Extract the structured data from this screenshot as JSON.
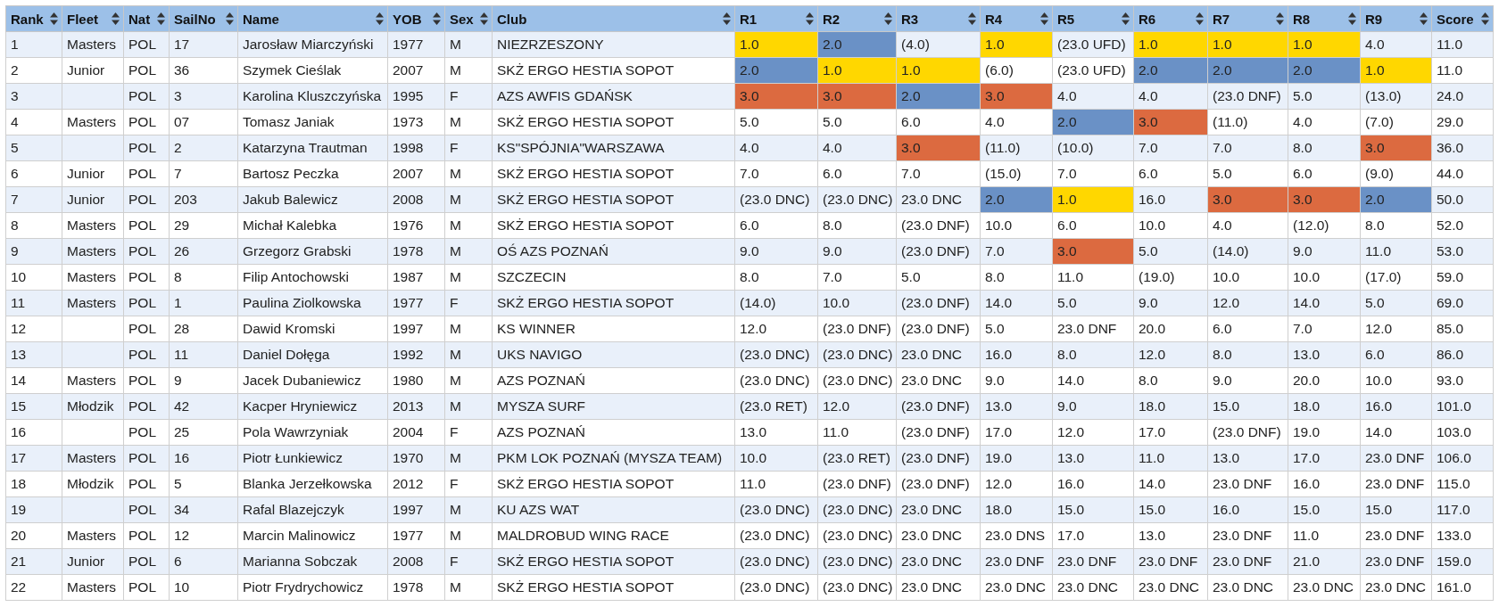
{
  "table": {
    "columns": [
      "Rank",
      "Fleet",
      "Nat",
      "SailNo",
      "Name",
      "YOB",
      "Sex",
      "Club",
      "R1",
      "R2",
      "R3",
      "R4",
      "R5",
      "R6",
      "R7",
      "R8",
      "R9",
      "Score"
    ],
    "rows": [
      {
        "rank": "1",
        "fleet": "Masters",
        "nat": "POL",
        "sail_no": "17",
        "name": "Jarosław Miarczyński",
        "yob": "1977",
        "sex": "M",
        "club": "NIEZRZESZONY",
        "races": [
          {
            "text": "1.0",
            "color": "#ffd700"
          },
          {
            "text": "2.0",
            "color": "#6a91c6"
          },
          {
            "text": "(4.0)"
          },
          {
            "text": "1.0",
            "color": "#ffd700"
          },
          {
            "text": "(23.0 UFD)"
          },
          {
            "text": "1.0",
            "color": "#ffd700"
          },
          {
            "text": "1.0",
            "color": "#ffd700"
          },
          {
            "text": "1.0",
            "color": "#ffd700"
          },
          {
            "text": "4.0"
          }
        ],
        "score": "11.0"
      },
      {
        "rank": "2",
        "fleet": "Junior",
        "nat": "POL",
        "sail_no": "36",
        "name": "Szymek Cieślak",
        "yob": "2007",
        "sex": "M",
        "club": "SKŻ ERGO HESTIA SOPOT",
        "races": [
          {
            "text": "2.0",
            "color": "#6a91c6"
          },
          {
            "text": "1.0",
            "color": "#ffd700"
          },
          {
            "text": "1.0",
            "color": "#ffd700"
          },
          {
            "text": "(6.0)"
          },
          {
            "text": "(23.0 UFD)"
          },
          {
            "text": "2.0",
            "color": "#6a91c6"
          },
          {
            "text": "2.0",
            "color": "#6a91c6"
          },
          {
            "text": "2.0",
            "color": "#6a91c6"
          },
          {
            "text": "1.0",
            "color": "#ffd700"
          }
        ],
        "score": "11.0"
      },
      {
        "rank": "3",
        "nat": "POL",
        "sail_no": "3",
        "name": "Karolina Kluszczyńska",
        "yob": "1995",
        "sex": "F",
        "club": "AZS AWFIS GDAŃSK",
        "races": [
          {
            "text": "3.0",
            "color": "#dc6a40"
          },
          {
            "text": "3.0",
            "color": "#dc6a40"
          },
          {
            "text": "2.0",
            "color": "#6a91c6"
          },
          {
            "text": "3.0",
            "color": "#dc6a40"
          },
          {
            "text": "4.0"
          },
          {
            "text": "4.0"
          },
          {
            "text": "(23.0 DNF)"
          },
          {
            "text": "5.0"
          },
          {
            "text": "(13.0)"
          }
        ],
        "score": "24.0"
      },
      {
        "rank": "4",
        "fleet": "Masters",
        "nat": "POL",
        "sail_no": "07",
        "name": "Tomasz Janiak",
        "yob": "1973",
        "sex": "M",
        "club": "SKŻ ERGO HESTIA SOPOT",
        "races": [
          {
            "text": "5.0"
          },
          {
            "text": "5.0"
          },
          {
            "text": "6.0"
          },
          {
            "text": "4.0"
          },
          {
            "text": "2.0",
            "color": "#6a91c6"
          },
          {
            "text": "3.0",
            "color": "#dc6a40"
          },
          {
            "text": "(11.0)"
          },
          {
            "text": "4.0"
          },
          {
            "text": "(7.0)"
          }
        ],
        "score": "29.0"
      },
      {
        "rank": "5",
        "nat": "POL",
        "sail_no": "2",
        "name": "Katarzyna Trautman",
        "yob": "1998",
        "sex": "F",
        "club": "KS\"SPÓJNIA\"WARSZAWA",
        "races": [
          {
            "text": "4.0"
          },
          {
            "text": "4.0"
          },
          {
            "text": "3.0",
            "color": "#dc6a40"
          },
          {
            "text": "(11.0)"
          },
          {
            "text": "(10.0)"
          },
          {
            "text": "7.0"
          },
          {
            "text": "7.0"
          },
          {
            "text": "8.0"
          },
          {
            "text": "3.0",
            "color": "#dc6a40"
          }
        ],
        "score": "36.0"
      },
      {
        "rank": "6",
        "fleet": "Junior",
        "nat": "POL",
        "sail_no": "7",
        "name": "Bartosz Peczka",
        "yob": "2007",
        "sex": "M",
        "club": "SKŻ ERGO HESTIA SOPOT",
        "races": [
          {
            "text": "7.0"
          },
          {
            "text": "6.0"
          },
          {
            "text": "7.0"
          },
          {
            "text": "(15.0)"
          },
          {
            "text": "7.0"
          },
          {
            "text": "6.0"
          },
          {
            "text": "5.0"
          },
          {
            "text": "6.0"
          },
          {
            "text": "(9.0)"
          }
        ],
        "score": "44.0"
      },
      {
        "rank": "7",
        "fleet": "Junior",
        "nat": "POL",
        "sail_no": "203",
        "name": "Jakub Balewicz",
        "yob": "2008",
        "sex": "M",
        "club": "SKŻ ERGO HESTIA SOPOT",
        "races": [
          {
            "text": "(23.0 DNC)"
          },
          {
            "text": "(23.0 DNC)"
          },
          {
            "text": "23.0 DNC"
          },
          {
            "text": "2.0",
            "color": "#6a91c6"
          },
          {
            "text": "1.0",
            "color": "#ffd700"
          },
          {
            "text": "16.0"
          },
          {
            "text": "3.0",
            "color": "#dc6a40"
          },
          {
            "text": "3.0",
            "color": "#dc6a40"
          },
          {
            "text": "2.0",
            "color": "#6a91c6"
          }
        ],
        "score": "50.0"
      },
      {
        "rank": "8",
        "fleet": "Masters",
        "nat": "POL",
        "sail_no": "29",
        "name": "Michał Kalebka",
        "yob": "1976",
        "sex": "M",
        "club": "SKŻ ERGO HESTIA SOPOT",
        "races": [
          {
            "text": "6.0"
          },
          {
            "text": "8.0"
          },
          {
            "text": "(23.0 DNF)"
          },
          {
            "text": "10.0"
          },
          {
            "text": "6.0"
          },
          {
            "text": "10.0"
          },
          {
            "text": "4.0"
          },
          {
            "text": "(12.0)"
          },
          {
            "text": "8.0"
          }
        ],
        "score": "52.0"
      },
      {
        "rank": "9",
        "fleet": "Masters",
        "nat": "POL",
        "sail_no": "26",
        "name": "Grzegorz Grabski",
        "yob": "1978",
        "sex": "M",
        "club": "OŚ AZS POZNAŃ",
        "races": [
          {
            "text": "9.0"
          },
          {
            "text": "9.0"
          },
          {
            "text": "(23.0 DNF)"
          },
          {
            "text": "7.0"
          },
          {
            "text": "3.0",
            "color": "#dc6a40"
          },
          {
            "text": "5.0"
          },
          {
            "text": "(14.0)"
          },
          {
            "text": "9.0"
          },
          {
            "text": "11.0"
          }
        ],
        "score": "53.0"
      },
      {
        "rank": "10",
        "fleet": "Masters",
        "nat": "POL",
        "sail_no": "8",
        "name": "Filip Antochowski",
        "yob": "1987",
        "sex": "M",
        "club": "SZCZECIN",
        "races": [
          {
            "text": "8.0"
          },
          {
            "text": "7.0"
          },
          {
            "text": "5.0"
          },
          {
            "text": "8.0"
          },
          {
            "text": "11.0"
          },
          {
            "text": "(19.0)"
          },
          {
            "text": "10.0"
          },
          {
            "text": "10.0"
          },
          {
            "text": "(17.0)"
          }
        ],
        "score": "59.0"
      },
      {
        "rank": "11",
        "fleet": "Masters",
        "nat": "POL",
        "sail_no": "1",
        "name": "Paulina Ziolkowska",
        "yob": "1977",
        "sex": "F",
        "club": "SKŻ ERGO HESTIA SOPOT",
        "races": [
          {
            "text": "(14.0)"
          },
          {
            "text": "10.0"
          },
          {
            "text": "(23.0 DNF)"
          },
          {
            "text": "14.0"
          },
          {
            "text": "5.0"
          },
          {
            "text": "9.0"
          },
          {
            "text": "12.0"
          },
          {
            "text": "14.0"
          },
          {
            "text": "5.0"
          }
        ],
        "score": "69.0"
      },
      {
        "rank": "12",
        "nat": "POL",
        "sail_no": "28",
        "name": "Dawid Kromski",
        "yob": "1997",
        "sex": "M",
        "club": "KS WINNER",
        "races": [
          {
            "text": "12.0"
          },
          {
            "text": "(23.0 DNF)"
          },
          {
            "text": "(23.0 DNF)"
          },
          {
            "text": "5.0"
          },
          {
            "text": "23.0 DNF"
          },
          {
            "text": "20.0"
          },
          {
            "text": "6.0"
          },
          {
            "text": "7.0"
          },
          {
            "text": "12.0"
          }
        ],
        "score": "85.0"
      },
      {
        "rank": "13",
        "nat": "POL",
        "sail_no": "11",
        "name": "Daniel Dołęga",
        "yob": "1992",
        "sex": "M",
        "club": "UKS NAVIGO",
        "races": [
          {
            "text": "(23.0 DNC)"
          },
          {
            "text": "(23.0 DNC)"
          },
          {
            "text": "23.0 DNC"
          },
          {
            "text": "16.0"
          },
          {
            "text": "8.0"
          },
          {
            "text": "12.0"
          },
          {
            "text": "8.0"
          },
          {
            "text": "13.0"
          },
          {
            "text": "6.0"
          }
        ],
        "score": "86.0"
      },
      {
        "rank": "14",
        "fleet": "Masters",
        "nat": "POL",
        "sail_no": "9",
        "name": "Jacek Dubaniewicz",
        "yob": "1980",
        "sex": "M",
        "club": "AZS POZNAŃ",
        "races": [
          {
            "text": "(23.0 DNC)"
          },
          {
            "text": "(23.0 DNC)"
          },
          {
            "text": "23.0 DNC"
          },
          {
            "text": "9.0"
          },
          {
            "text": "14.0"
          },
          {
            "text": "8.0"
          },
          {
            "text": "9.0"
          },
          {
            "text": "20.0"
          },
          {
            "text": "10.0"
          }
        ],
        "score": "93.0"
      },
      {
        "rank": "15",
        "fleet": "Młodzik",
        "nat": "POL",
        "sail_no": "42",
        "name": "Kacper Hryniewicz",
        "yob": "2013",
        "sex": "M",
        "club": "MYSZA SURF",
        "races": [
          {
            "text": "(23.0 RET)"
          },
          {
            "text": "12.0"
          },
          {
            "text": "(23.0 DNF)"
          },
          {
            "text": "13.0"
          },
          {
            "text": "9.0"
          },
          {
            "text": "18.0"
          },
          {
            "text": "15.0"
          },
          {
            "text": "18.0"
          },
          {
            "text": "16.0"
          }
        ],
        "score": "101.0"
      },
      {
        "rank": "16",
        "nat": "POL",
        "sail_no": "25",
        "name": "Pola Wawrzyniak",
        "yob": "2004",
        "sex": "F",
        "club": "AZS POZNAŃ",
        "races": [
          {
            "text": "13.0"
          },
          {
            "text": "11.0"
          },
          {
            "text": "(23.0 DNF)"
          },
          {
            "text": "17.0"
          },
          {
            "text": "12.0"
          },
          {
            "text": "17.0"
          },
          {
            "text": "(23.0 DNF)"
          },
          {
            "text": "19.0"
          },
          {
            "text": "14.0"
          }
        ],
        "score": "103.0"
      },
      {
        "rank": "17",
        "fleet": "Masters",
        "nat": "POL",
        "sail_no": "16",
        "name": "Piotr Łunkiewicz",
        "yob": "1970",
        "sex": "M",
        "club": "PKM LOK POZNAŃ (MYSZA TEAM)",
        "races": [
          {
            "text": "10.0"
          },
          {
            "text": "(23.0 RET)"
          },
          {
            "text": "(23.0 DNF)"
          },
          {
            "text": "19.0"
          },
          {
            "text": "13.0"
          },
          {
            "text": "11.0"
          },
          {
            "text": "13.0"
          },
          {
            "text": "17.0"
          },
          {
            "text": "23.0 DNF"
          }
        ],
        "score": "106.0"
      },
      {
        "rank": "18",
        "fleet": "Młodzik",
        "nat": "POL",
        "sail_no": "5",
        "name": "Blanka Jerzełkowska",
        "yob": "2012",
        "sex": "F",
        "club": "SKŻ ERGO HESTIA SOPOT",
        "races": [
          {
            "text": "11.0"
          },
          {
            "text": "(23.0 DNF)"
          },
          {
            "text": "(23.0 DNF)"
          },
          {
            "text": "12.0"
          },
          {
            "text": "16.0"
          },
          {
            "text": "14.0"
          },
          {
            "text": "23.0 DNF"
          },
          {
            "text": "16.0"
          },
          {
            "text": "23.0 DNF"
          }
        ],
        "score": "115.0"
      },
      {
        "rank": "19",
        "nat": "POL",
        "sail_no": "34",
        "name": "Rafal Blazejczyk",
        "yob": "1997",
        "sex": "M",
        "club": "KU AZS WAT",
        "races": [
          {
            "text": "(23.0 DNC)"
          },
          {
            "text": "(23.0 DNC)"
          },
          {
            "text": "23.0 DNC"
          },
          {
            "text": "18.0"
          },
          {
            "text": "15.0"
          },
          {
            "text": "15.0"
          },
          {
            "text": "16.0"
          },
          {
            "text": "15.0"
          },
          {
            "text": "15.0"
          }
        ],
        "score": "117.0"
      },
      {
        "rank": "20",
        "fleet": "Masters",
        "nat": "POL",
        "sail_no": "12",
        "name": "Marcin Malinowicz",
        "yob": "1977",
        "sex": "M",
        "club": "MALDROBUD WING RACE",
        "races": [
          {
            "text": "(23.0 DNC)"
          },
          {
            "text": "(23.0 DNC)"
          },
          {
            "text": "23.0 DNC"
          },
          {
            "text": "23.0 DNS"
          },
          {
            "text": "17.0"
          },
          {
            "text": "13.0"
          },
          {
            "text": "23.0 DNF"
          },
          {
            "text": "11.0"
          },
          {
            "text": "23.0 DNF"
          }
        ],
        "score": "133.0"
      },
      {
        "rank": "21",
        "fleet": "Junior",
        "nat": "POL",
        "sail_no": "6",
        "name": "Marianna Sobczak",
        "yob": "2008",
        "sex": "F",
        "club": "SKŻ ERGO HESTIA SOPOT",
        "races": [
          {
            "text": "(23.0 DNC)"
          },
          {
            "text": "(23.0 DNC)"
          },
          {
            "text": "23.0 DNC"
          },
          {
            "text": "23.0 DNF"
          },
          {
            "text": "23.0 DNF"
          },
          {
            "text": "23.0 DNF"
          },
          {
            "text": "23.0 DNF"
          },
          {
            "text": "21.0"
          },
          {
            "text": "23.0 DNF"
          }
        ],
        "score": "159.0"
      },
      {
        "rank": "22",
        "fleet": "Masters",
        "nat": "POL",
        "sail_no": "10",
        "name": "Piotr Frydrychowicz",
        "yob": "1978",
        "sex": "M",
        "club": "SKŻ ERGO HESTIA SOPOT",
        "races": [
          {
            "text": "(23.0 DNC)"
          },
          {
            "text": "(23.0 DNC)"
          },
          {
            "text": "23.0 DNC"
          },
          {
            "text": "23.0 DNC"
          },
          {
            "text": "23.0 DNC"
          },
          {
            "text": "23.0 DNC"
          },
          {
            "text": "23.0 DNC"
          },
          {
            "text": "23.0 DNC"
          },
          {
            "text": "23.0 DNC"
          }
        ],
        "score": "161.0"
      }
    ]
  }
}
